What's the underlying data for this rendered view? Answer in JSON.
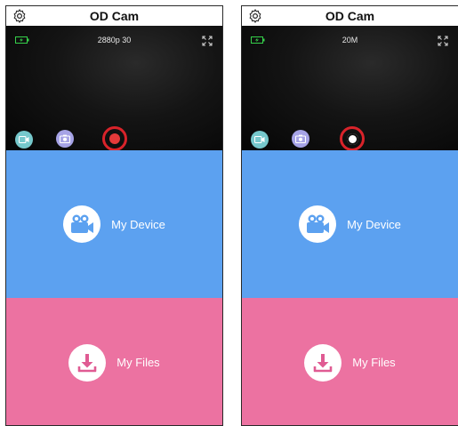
{
  "colors": {
    "device_panel": "#5ca1f0",
    "files_panel": "#ec72a1",
    "record_dot": "#e53a3a",
    "highlight_ring": "#d9232a",
    "battery": "#35d04a"
  },
  "screens": [
    {
      "app_title": "OD Cam",
      "mode_text": "2880p 30",
      "active_mode": "video",
      "icons": [
        "settings-gear-icon",
        "battery-icon",
        "expand-icon",
        "video-camera-icon",
        "photo-camera-icon",
        "record-button"
      ],
      "my_device_label": "My Device",
      "my_files_label": "My Files"
    },
    {
      "app_title": "OD Cam",
      "mode_text": "20M",
      "active_mode": "photo",
      "icons": [
        "settings-gear-icon",
        "battery-icon",
        "expand-icon",
        "video-camera-icon",
        "photo-camera-icon",
        "shutter-button"
      ],
      "my_device_label": "My Device",
      "my_files_label": "My Files"
    }
  ]
}
